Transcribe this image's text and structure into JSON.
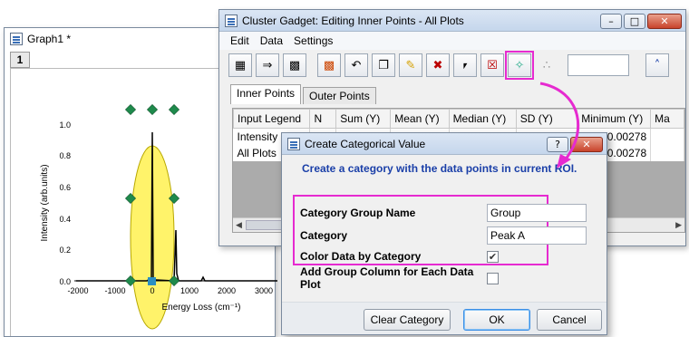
{
  "graph": {
    "title": "Graph1 *",
    "layer": "1",
    "y_label": "Intensity (arb.units)",
    "x_label": "Energy Loss (cm⁻¹)",
    "y_ticks": [
      "1.0",
      "0.8",
      "0.6",
      "0.4",
      "0.2",
      "0.0"
    ],
    "x_ticks": [
      "-2000",
      "-1000",
      "0",
      "1000",
      "2000",
      "3000"
    ]
  },
  "cluster": {
    "title": "Cluster Gadget: Editing Inner Points - All Plots",
    "menu": [
      "Edit",
      "Data",
      "Settings"
    ],
    "tabs": [
      "Inner Points",
      "Outer Points"
    ],
    "columns": [
      "Input Legend",
      "N",
      "Sum (Y)",
      "Mean (Y)",
      "Median (Y)",
      "SD (Y)",
      "Minimum (Y)",
      "Ma"
    ],
    "rows": [
      {
        "legend": "Intensity",
        "minimum": "0.00278"
      },
      {
        "legend": "All Plots",
        "minimum": "0.00278"
      }
    ]
  },
  "dialog": {
    "title": "Create Categorical Value",
    "heading": "Create a category with the data points in current ROI.",
    "group_label": "Category Group Name",
    "group_value": "Group",
    "category_label": "Category",
    "category_value": "Peak A",
    "color_label": "Color Data by Category",
    "color_checked": "✔",
    "add_label": "Add Group Column for Each Data Plot",
    "clear_button": "Clear Category",
    "ok_button": "OK",
    "cancel_button": "Cancel",
    "help_glyph": "?",
    "close_glyph": "✕"
  },
  "colors": {
    "highlight": "#e62ad0",
    "roi_fill": "#fff36a",
    "marker": "#1f8a4c",
    "heading": "#1a3fa8"
  }
}
